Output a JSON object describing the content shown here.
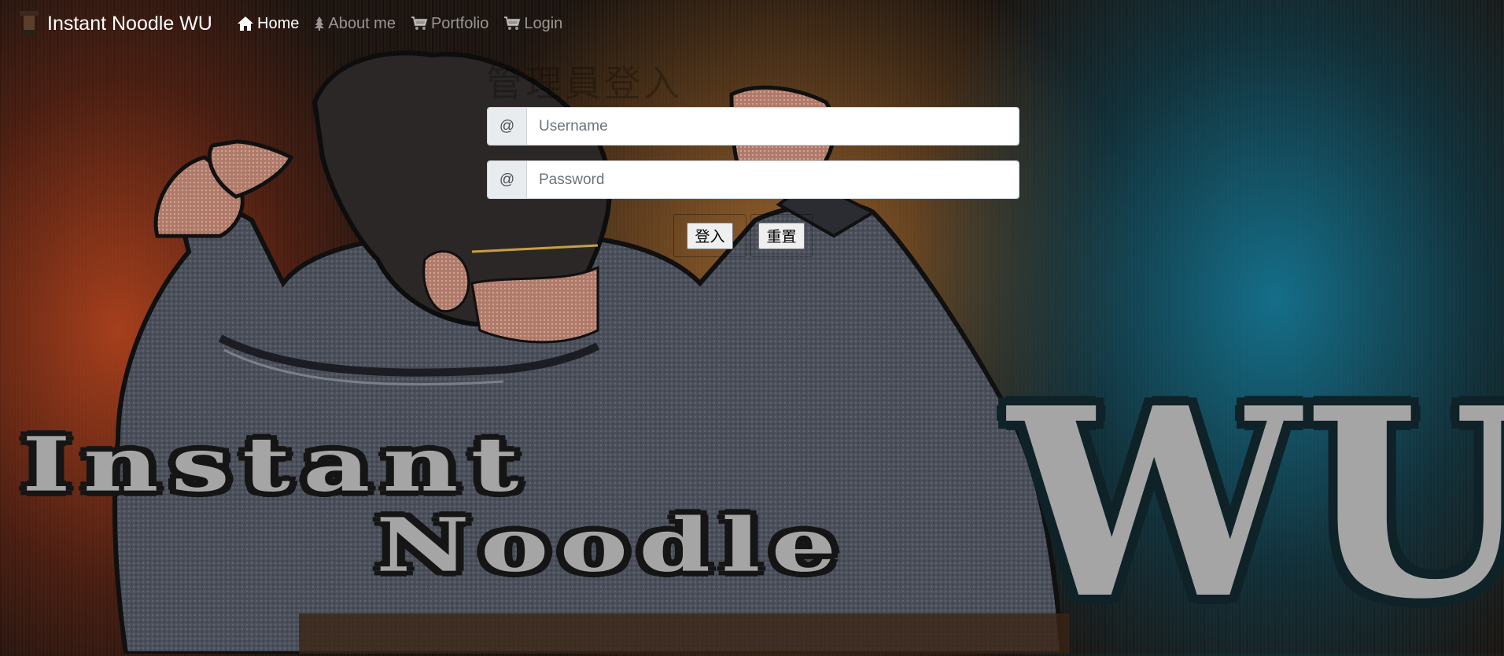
{
  "navbar": {
    "brand": "Instant Noodle WU",
    "items": [
      {
        "label": "Home",
        "icon": "home-icon",
        "active": true
      },
      {
        "label": "About me",
        "icon": "tree-icon",
        "active": false
      },
      {
        "label": "Portfolio",
        "icon": "cart-icon",
        "active": false
      },
      {
        "label": "Login",
        "icon": "cart-icon",
        "active": false
      }
    ]
  },
  "login": {
    "title": "管理員登入",
    "username": {
      "addon": "@",
      "placeholder": "Username",
      "value": ""
    },
    "password": {
      "addon": "@",
      "placeholder": "Password",
      "value": ""
    },
    "submit_label": "登入",
    "reset_label": "重置"
  },
  "hero": {
    "logo_lines": [
      "Instant",
      "Noodle",
      "WU"
    ]
  },
  "colors": {
    "accent_red": "#b8442a",
    "accent_teal": "#13748e",
    "input_addon_bg": "#e9ecef",
    "logo_text": "#a5a5a5"
  }
}
